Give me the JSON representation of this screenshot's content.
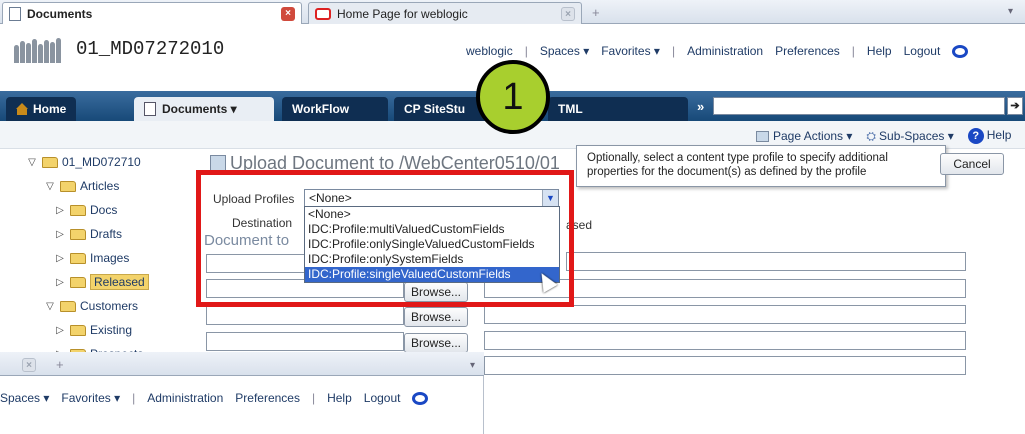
{
  "browser": {
    "tabs": [
      {
        "label": "Documents",
        "close": "×"
      },
      {
        "label": "Home Page for weblogic"
      }
    ],
    "new_tab": "+",
    "overflow": "▾"
  },
  "header": {
    "site_title": "01_MD07272010",
    "user": "weblogic",
    "nav": [
      "Spaces ▾",
      "Favorites ▾",
      "Administration",
      "Preferences",
      "Help",
      "Logout"
    ]
  },
  "appbar": {
    "tabs": [
      "Home",
      "Documents ▾",
      "WorkFlow",
      "CP SiteStu",
      "TML"
    ],
    "overflow": "»",
    "go": "➔"
  },
  "subbar": {
    "page_actions": "Page Actions ▾",
    "sub_spaces": "Sub-Spaces ▾",
    "help": "Help",
    "help_icon": "?"
  },
  "tree": [
    {
      "label": "01_MD072710",
      "twisty": "▽",
      "indent": 0
    },
    {
      "label": "Articles",
      "twisty": "▽",
      "indent": 1
    },
    {
      "label": "Docs",
      "twisty": "▷",
      "indent": 2
    },
    {
      "label": "Drafts",
      "twisty": "▷",
      "indent": 2
    },
    {
      "label": "Images",
      "twisty": "▷",
      "indent": 2
    },
    {
      "label": "Released",
      "twisty": "▷",
      "indent": 2,
      "selected": true
    },
    {
      "label": "Customers",
      "twisty": "▽",
      "indent": 1
    },
    {
      "label": "Existing",
      "twisty": "▷",
      "indent": 2
    },
    {
      "label": "Prospects",
      "twisty": "▷",
      "indent": 2
    }
  ],
  "upload": {
    "title": "Upload Document to /WebCenter0510/01_",
    "profiles_label": "Upload Profiles",
    "profiles_value": "<None>",
    "destination_label": "Destination",
    "destination_value_tail": "ased",
    "document_label": "Document to",
    "browse": "Browse...",
    "cancel": "Cancel",
    "options": [
      "<None>",
      "IDC:Profile:multiValuedCustomFields",
      "IDC:Profile:onlySingleValuedCustomFields",
      "IDC:Profile:onlySystemFields",
      "IDC:Profile:singleValuedCustomFields"
    ],
    "selected_option": 4
  },
  "tooltip": {
    "line1": "Optionally, select a content type profile to specify additional",
    "line2": "properties for the document(s) as defined by the profile"
  },
  "callout": {
    "number": "1"
  },
  "fragment": {
    "nav": [
      "Spaces ▾",
      "Favorites ▾",
      "Administration",
      "Preferences",
      "Help",
      "Logout"
    ]
  },
  "colors": {
    "accent": "#174978",
    "highlight": "#e11818",
    "badge": "#a8cf2e"
  }
}
